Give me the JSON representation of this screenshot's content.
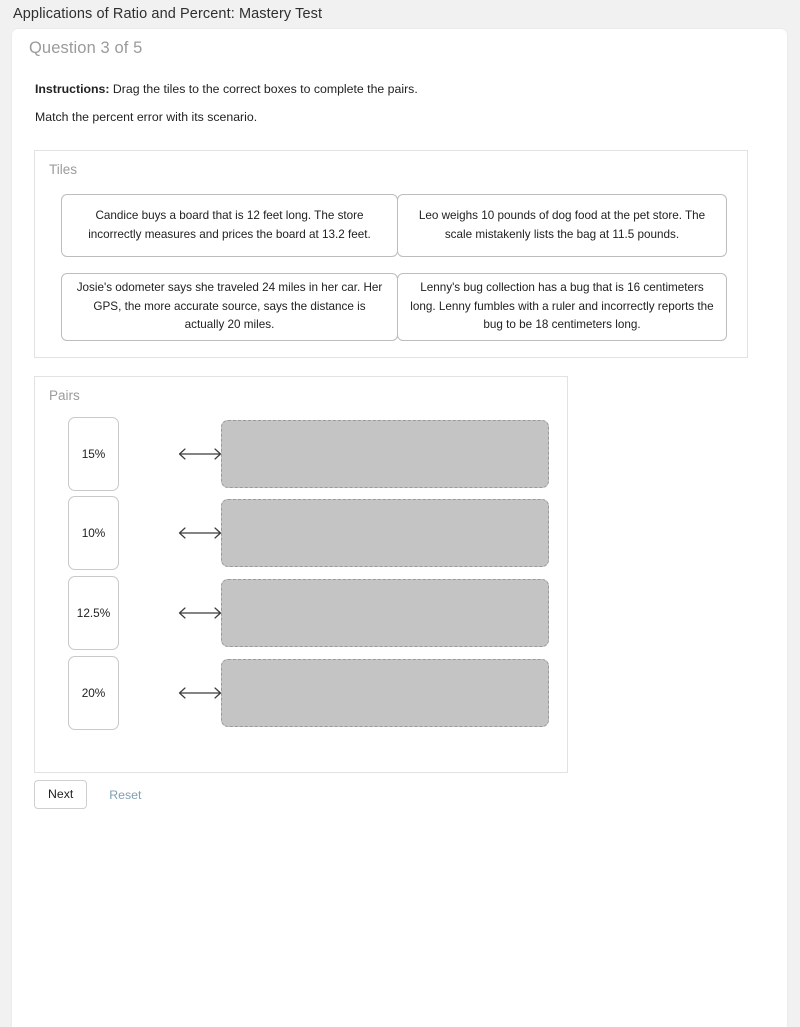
{
  "assessment": {
    "title": "Applications of Ratio and Percent: Mastery Test"
  },
  "question": {
    "counter": "Question 3 of 5",
    "instructions_label": "Instructions:",
    "instructions_text": "Drag the tiles to the correct boxes to complete the pairs.",
    "prompt": "Match the percent error with its scenario."
  },
  "tiles_panel": {
    "label": "Tiles",
    "tiles": [
      {
        "text": "Candice buys a board that is 12 feet long. The store incorrectly measures and prices the board at 13.2 feet."
      },
      {
        "text": "Leo weighs 10 pounds of dog food at the pet store. The scale mistakenly lists the bag at 11.5 pounds."
      },
      {
        "text": "Josie's odometer says she traveled 24 miles in her car. Her GPS, the more accurate source, says the distance is actually 20 miles."
      },
      {
        "text": "Lenny's bug collection has a bug that is 16 centimeters long. Lenny fumbles with a ruler and incorrectly reports the bug to be 18 centimeters long."
      }
    ]
  },
  "pairs_panel": {
    "label": "Pairs",
    "arrow_icon": "double-headed-arrow",
    "rows": [
      {
        "percent": "15%",
        "drop_zone_text": ""
      },
      {
        "percent": "10%",
        "drop_zone_text": ""
      },
      {
        "percent": "12.5%",
        "drop_zone_text": ""
      },
      {
        "percent": "20%",
        "drop_zone_text": ""
      }
    ]
  },
  "actions": {
    "next_label": "Next",
    "reset_label": "Reset"
  },
  "colors": {
    "page_background": "#f1f1f1",
    "card_background": "#ffffff",
    "panel_border": "#e2e2e2",
    "muted_text": "#9b9b9b",
    "body_text": "#222222",
    "drop_zone_fill": "#c4c4c4",
    "drop_zone_border": "#9a9a9a",
    "reset_link": "#7f9fb3"
  }
}
